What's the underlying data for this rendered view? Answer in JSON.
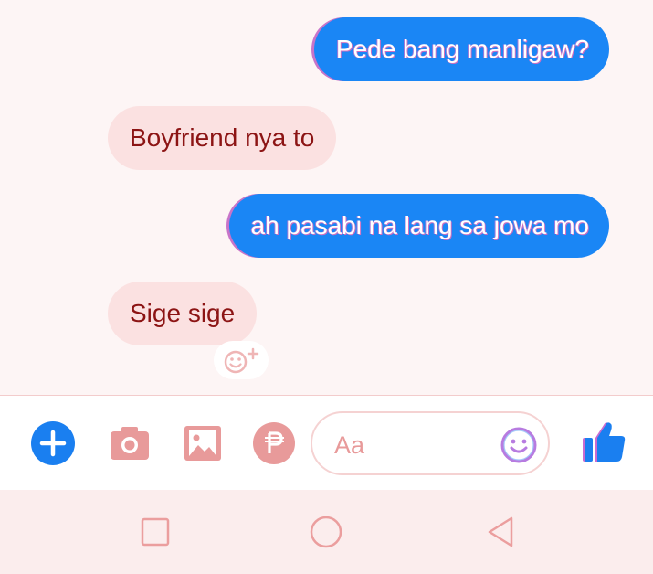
{
  "messages": [
    {
      "direction": "outgoing",
      "text": "Pede bang manligaw?"
    },
    {
      "direction": "incoming",
      "text": "Boyfriend nya to"
    },
    {
      "direction": "outgoing",
      "text": "ah pasabi na lang sa jowa mo"
    },
    {
      "direction": "incoming",
      "text": "Sige sige"
    }
  ],
  "reaction_button": {
    "icon": "add-reaction-icon"
  },
  "composer": {
    "placeholder": "Aa",
    "value": "",
    "actions": [
      {
        "name": "plus-icon"
      },
      {
        "name": "camera-icon"
      },
      {
        "name": "image-icon"
      },
      {
        "name": "peso-payment-icon"
      }
    ],
    "emoji_icon": "smiley-icon",
    "like_icon": "thumbs-up-icon"
  },
  "system_nav": {
    "recents_icon": "square-icon",
    "home_icon": "circle-icon",
    "back_icon": "triangle-back-icon"
  },
  "colors": {
    "outgoing_bubble": "#1a86f5",
    "incoming_bubble": "#fbe1e1",
    "incoming_text": "#8c1414",
    "accent_icon": "#e89a9a"
  }
}
